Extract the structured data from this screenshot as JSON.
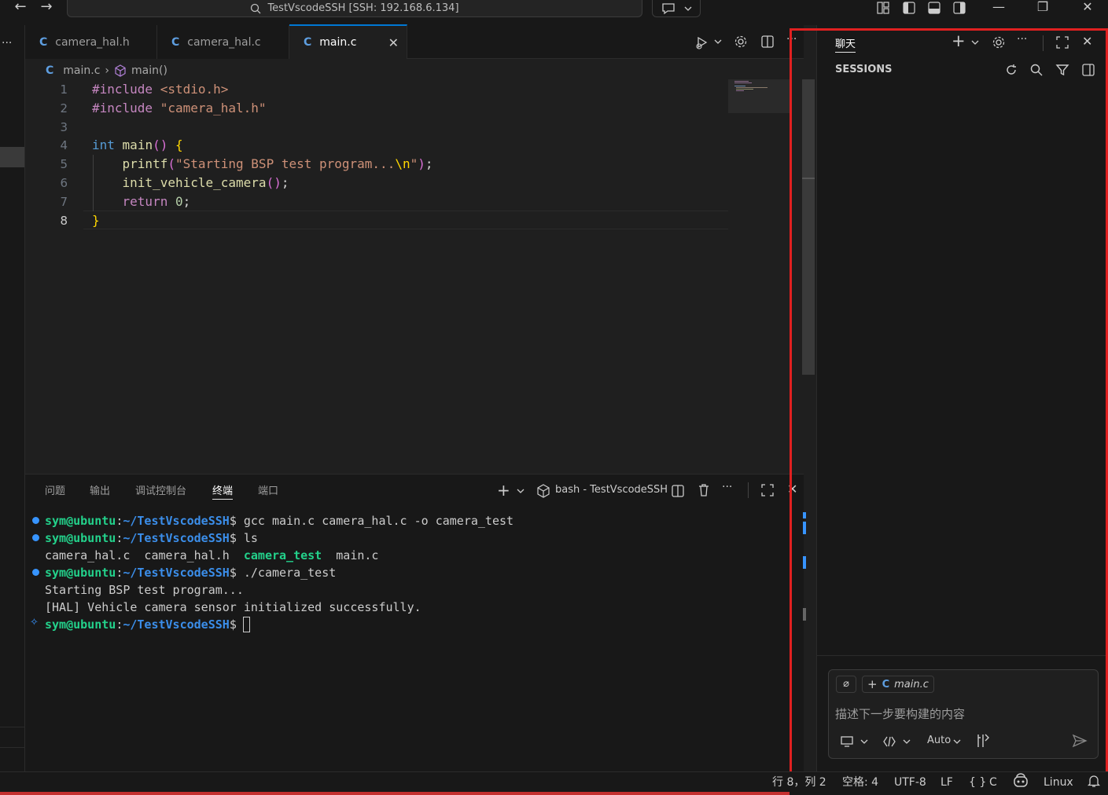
{
  "window": {
    "title": "TestVscodeSSH [SSH: 192.168.6.134]"
  },
  "tabs": [
    {
      "label": "camera_hal.h",
      "active": false
    },
    {
      "label": "camera_hal.c",
      "active": false
    },
    {
      "label": "main.c",
      "active": true
    }
  ],
  "breadcrumb": {
    "file": "main.c",
    "symbol": "main()"
  },
  "editor": {
    "current_line": 8,
    "line_numbers": [
      "1",
      "2",
      "3",
      "4",
      "5",
      "6",
      "7",
      "8"
    ]
  },
  "panel": {
    "tabs": [
      "问题",
      "输出",
      "调试控制台",
      "终端",
      "端口"
    ],
    "active_tab": "终端",
    "terminal_name": "bash - TestVscodeSSH",
    "prompt_user": "sym@ubuntu",
    "prompt_path": "~/TestVscodeSSH",
    "lines": {
      "cmd1": "gcc main.c camera_hal.c -o camera_test",
      "cmd2": "ls",
      "ls_a": "camera_hal.c  camera_hal.h  ",
      "ls_exe": "camera_test",
      "ls_b": "  main.c",
      "cmd3": "./camera_test",
      "out1": "Starting BSP test program...",
      "out2": "[HAL] Vehicle camera sensor initialized successfully."
    }
  },
  "chat": {
    "tab_title": "聊天",
    "sessions_label": "SESSIONS",
    "context_file": "main.c",
    "input_placeholder": "描述下一步要构建的内容",
    "mode_label": "Auto"
  },
  "statusbar": {
    "position": "行 8，列 2",
    "spaces": "空格: 4",
    "encoding": "UTF-8",
    "eol": "LF",
    "language": "C",
    "os": "Linux"
  },
  "colors": {
    "accent": "#0078d4",
    "highlight_box": "#e02020"
  }
}
